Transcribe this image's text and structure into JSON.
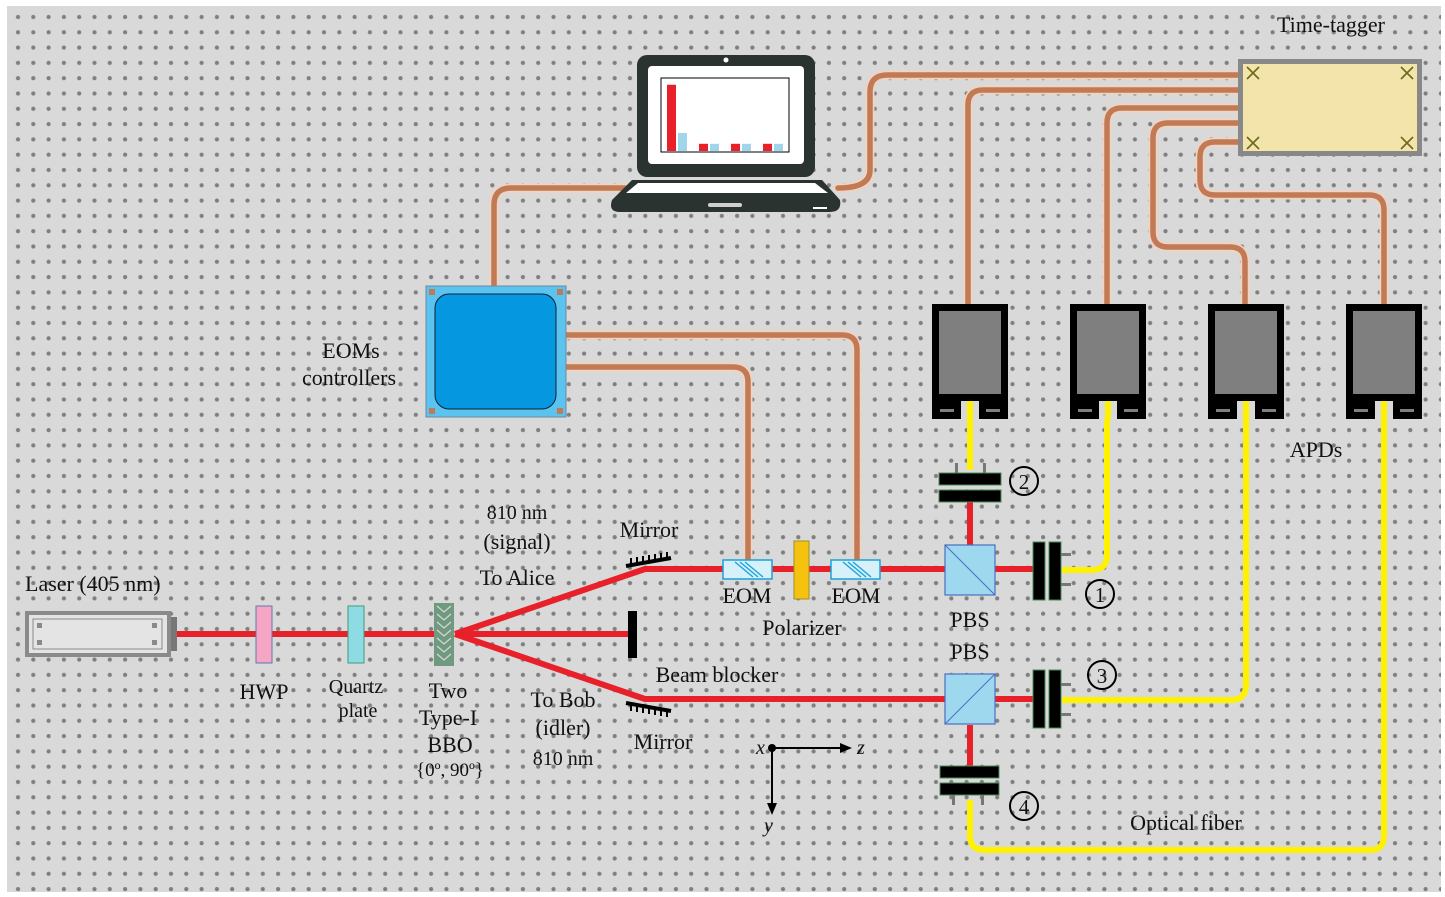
{
  "colors": {
    "board": "#d9d9d9",
    "hole": "#7f7f7f",
    "beam": "#e8202a",
    "fiber": "#fff200",
    "cable": "#c07a55",
    "cable_edge": "#f3d2bf",
    "hwp": "#f4a6c4",
    "quartz": "#8fdbe4",
    "eom": "#d6f1fa",
    "eom_edge": "#1aa3d9",
    "polarizer": "#f5c210",
    "pbs": "#9ed8ef",
    "controller_outer": "#5bc3f0",
    "controller_inner": "#0597e0",
    "timetagger": "#f3e4ac",
    "apd_body": "#000000",
    "apd_window": "#7f7f7f",
    "laptop": "#2b3331",
    "chart_red": "#e8202a",
    "chart_blue": "#9fd6ea"
  },
  "labels": {
    "laser": "Laser (405 nm)",
    "hwp": "HWP",
    "quartz_1": "Quartz",
    "quartz_2": "plate",
    "bbo_1": "Two",
    "bbo_2": "Type-I",
    "bbo_3": "BBO",
    "bbo_4": "{0º, 90º}",
    "signal_1": "810 nm",
    "signal_2": "(signal)",
    "to_alice": "To Alice",
    "to_bob_1": "To Bob",
    "to_bob_2": "(idler)",
    "to_bob_3": "810 nm",
    "mirror_top": "Mirror",
    "mirror_bottom": "Mirror",
    "beam_blocker": "Beam blocker",
    "eom_1": "EOM",
    "eom_2": "EOM",
    "polarizer": "Polarizer",
    "pbs_top": "PBS",
    "pbs_bottom": "PBS",
    "eom_controllers_1": "EOMs",
    "eom_controllers_2": "controllers",
    "time_tagger": "Time-tagger",
    "apds": "APDs",
    "optical_fiber": "Optical fiber",
    "axis_x": "x",
    "axis_y": "y",
    "axis_z": "z",
    "detector_1": "1",
    "detector_2": "2",
    "detector_3": "3",
    "detector_4": "4"
  },
  "icons": {
    "laptop": "laptop-icon",
    "histogram": "bar-chart-icon"
  },
  "laptop_histogram": {
    "red": [
      0.92,
      0.1,
      0.1,
      0.1
    ],
    "blue": [
      0.25,
      0.1,
      0.1,
      0.1
    ]
  }
}
